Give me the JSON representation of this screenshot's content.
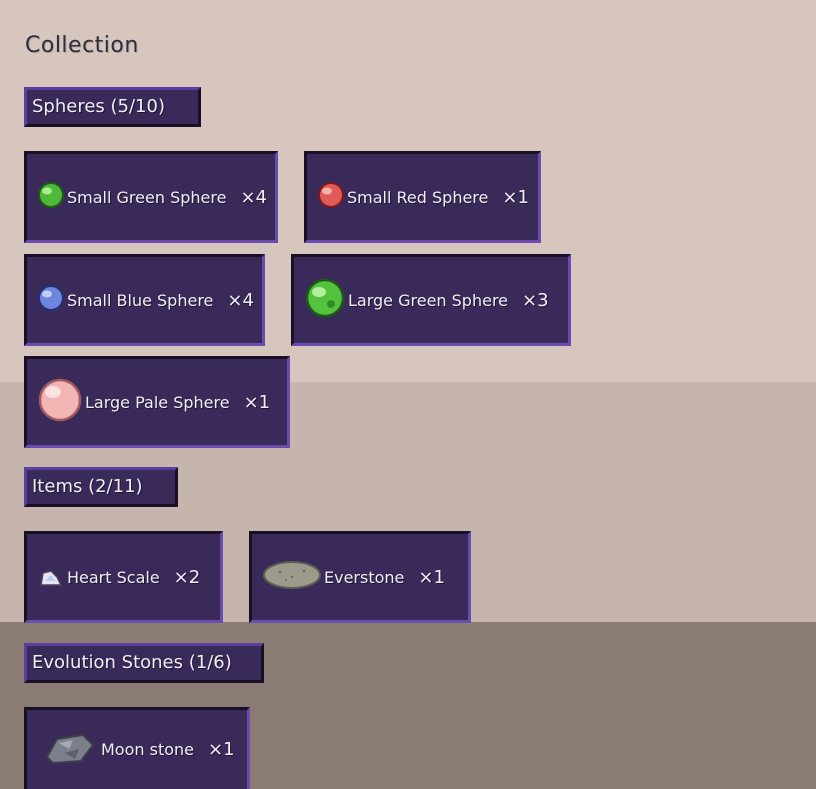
{
  "title": "Collection",
  "sections": [
    {
      "header": "Spheres (5/10)",
      "items": [
        {
          "name": "Small Green Sphere",
          "qty": "×4",
          "icon": "small-green-sphere-icon"
        },
        {
          "name": "Small Red Sphere",
          "qty": "×1",
          "icon": "small-red-sphere-icon"
        },
        {
          "name": "Small Blue Sphere",
          "qty": "×4",
          "icon": "small-blue-sphere-icon"
        },
        {
          "name": "Large Green Sphere",
          "qty": "×3",
          "icon": "large-green-sphere-icon"
        },
        {
          "name": "Large Pale Sphere",
          "qty": "×1",
          "icon": "large-pale-sphere-icon"
        }
      ]
    },
    {
      "header": "Items (2/11)",
      "items": [
        {
          "name": "Heart Scale",
          "qty": "×2",
          "icon": "heart-scale-icon"
        },
        {
          "name": "Everstone",
          "qty": "×1",
          "icon": "everstone-icon"
        }
      ]
    },
    {
      "header": "Evolution Stones (1/6)",
      "items": [
        {
          "name": "Moon stone",
          "qty": "×1",
          "icon": "moon-stone-icon"
        }
      ]
    }
  ],
  "colors": {
    "panel": "#3a2a5a",
    "panel_border_light": "#6a4bb0",
    "panel_border_dark": "#1a1026",
    "bg_top": "#d6c6bd",
    "bg_mid": "#c5b5ac",
    "bg_bottom": "#8b7c73"
  }
}
